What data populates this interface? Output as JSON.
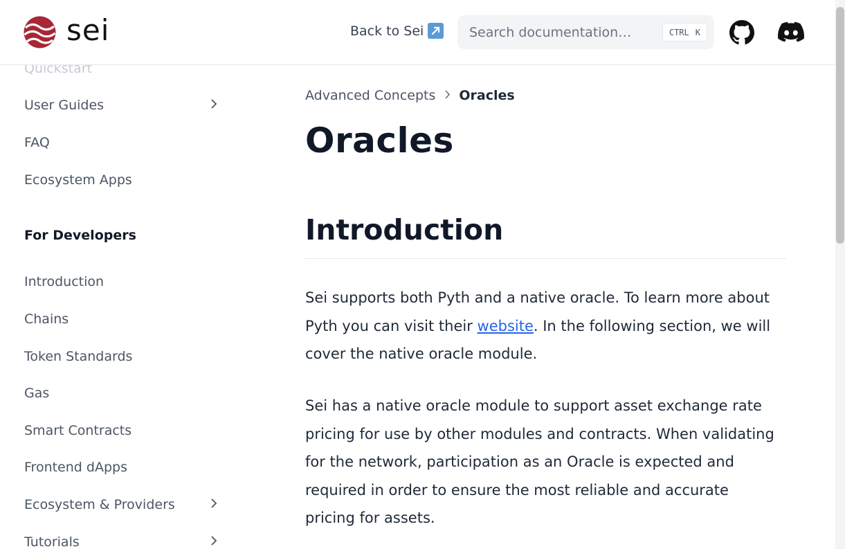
{
  "header": {
    "logo_text": "sei",
    "back_link": "Back to Sei",
    "search_placeholder": "Search documentation…",
    "shortcut_ctrl": "CTRL",
    "shortcut_key": "K"
  },
  "sidebar": {
    "partial_top_item": "Quickstart",
    "items_top": [
      {
        "label": "User Guides",
        "expandable": true
      },
      {
        "label": "FAQ",
        "expandable": false
      },
      {
        "label": "Ecosystem Apps",
        "expandable": false
      }
    ],
    "section_heading": "For Developers",
    "items_dev": [
      {
        "label": "Introduction",
        "expandable": false
      },
      {
        "label": "Chains",
        "expandable": false
      },
      {
        "label": "Token Standards",
        "expandable": false
      },
      {
        "label": "Gas",
        "expandable": false
      },
      {
        "label": "Smart Contracts",
        "expandable": false
      },
      {
        "label": "Frontend dApps",
        "expandable": false
      },
      {
        "label": "Ecosystem & Providers",
        "expandable": true
      },
      {
        "label": "Tutorials",
        "expandable": true
      }
    ]
  },
  "breadcrumb": {
    "parent": "Advanced Concepts",
    "current": "Oracles"
  },
  "content": {
    "title": "Oracles",
    "section_heading": "Introduction",
    "p1_before_link": "Sei supports both Pyth and a native oracle. To learn more about Pyth you can visit their ",
    "p1_link": "website",
    "p1_after_link": ". In the following section, we will cover the native oracle module.",
    "p2": "Sei has a native oracle module to support asset exchange rate pricing for use by other modules and contracts. When validating for the network, participation as an Oracle is expected and required in order to ensure the most reliable and accurate pricing for assets."
  },
  "colors": {
    "brand_red": "#a62834",
    "link_blue": "#2563eb",
    "text_dark": "#111827",
    "text_muted": "#4b5563"
  }
}
